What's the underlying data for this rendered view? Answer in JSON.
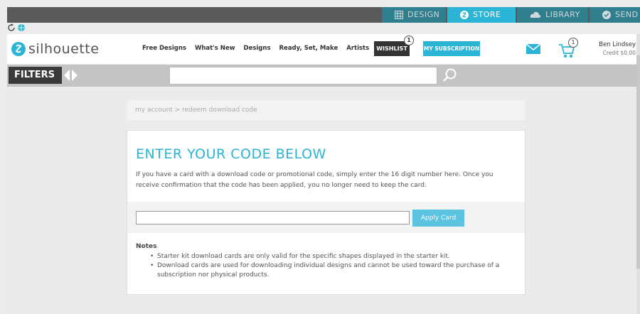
{
  "topbar": {
    "tabs": [
      {
        "label": "DESIGN",
        "icon": "grid-icon"
      },
      {
        "label": "STORE",
        "icon": "store-icon"
      },
      {
        "label": "LIBRARY",
        "icon": "cloud-icon"
      },
      {
        "label": "SEND",
        "icon": "check-icon"
      }
    ]
  },
  "header": {
    "logo_text": "silhouette",
    "nav": [
      "Free Designs",
      "What's New",
      "Designs",
      "Ready, Set, Make",
      "Artists"
    ],
    "wishlist_label": "WISHLIST",
    "wishlist_badge": "1",
    "subscription_label": "MY SUBSCRIPTION",
    "cart_badge": "1",
    "user_name": "Ben Lindsey",
    "user_credit": "Credit $0.00"
  },
  "filterbar": {
    "filters_label": "FILTERS",
    "search_value": ""
  },
  "breadcrumb": "my account > redeem download code",
  "card": {
    "title": "ENTER YOUR CODE BELOW",
    "description": "If you have a card with a download code or promotional code, simply enter the 16 digit number here. Once you receive confirmation that the code has been applied, you no longer need to keep the card.",
    "code_value": "",
    "apply_label": "Apply Card",
    "notes_title": "Notes",
    "notes": [
      "Starter kit download cards are only valid for the specific shapes displayed in the starter kit.",
      "Download cards are used for downloading individual designs and cannot be used toward the purchase of a subscription nor physical products."
    ]
  },
  "colors": {
    "accent": "#2cb4d6",
    "tab_dark": "#2f7f8e",
    "topbar": "#5a5a5a"
  }
}
